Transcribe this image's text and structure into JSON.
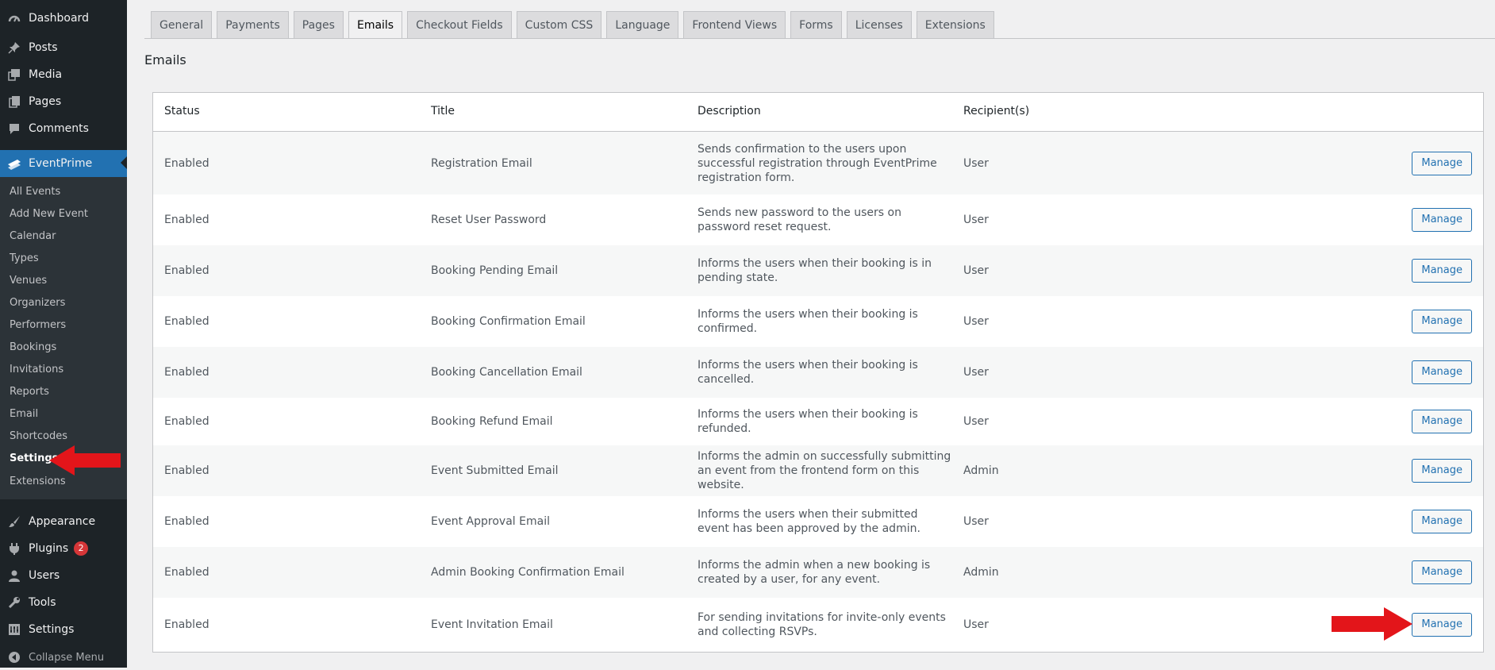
{
  "sidebar": {
    "items": [
      {
        "label": "Dashboard",
        "icon": "dashboard-icon"
      },
      {
        "label": "Posts",
        "icon": "pushpin-icon"
      },
      {
        "label": "Media",
        "icon": "media-icon"
      },
      {
        "label": "Pages",
        "icon": "pages-icon"
      },
      {
        "label": "Comments",
        "icon": "comments-icon"
      },
      {
        "label": "EventPrime",
        "icon": "eventprime-icon"
      }
    ],
    "submenu": [
      "All Events",
      "Add New Event",
      "Calendar",
      "Types",
      "Venues",
      "Organizers",
      "Performers",
      "Bookings",
      "Invitations",
      "Reports",
      "Email",
      "Shortcodes",
      "Settings",
      "Extensions"
    ],
    "current_submenu": "Settings",
    "bottom_items": [
      {
        "label": "Appearance",
        "icon": "paintbrush-icon"
      },
      {
        "label": "Plugins",
        "icon": "plugins-icon",
        "badge": "2"
      },
      {
        "label": "Users",
        "icon": "users-icon"
      },
      {
        "label": "Tools",
        "icon": "tools-icon"
      },
      {
        "label": "Settings",
        "icon": "settings-icon"
      }
    ],
    "collapse_label": "Collapse Menu"
  },
  "tabs": [
    "General",
    "Payments",
    "Pages",
    "Emails",
    "Checkout Fields",
    "Custom CSS",
    "Language",
    "Frontend Views",
    "Forms",
    "Licenses",
    "Extensions"
  ],
  "active_tab": "Emails",
  "page_title": "Emails",
  "table": {
    "headers": {
      "status": "Status",
      "title": "Title",
      "description": "Description",
      "recipients": "Recipient(s)"
    },
    "rows": [
      {
        "status": "Enabled",
        "title": "Registration Email",
        "description": "Sends confirmation to the users upon successful registration through EventPrime registration form.",
        "recipient": "User",
        "action": "Manage"
      },
      {
        "status": "Enabled",
        "title": "Reset User Password",
        "description": "Sends new password to the users on password reset request.",
        "recipient": "User",
        "action": "Manage"
      },
      {
        "status": "Enabled",
        "title": "Booking Pending Email",
        "description": "Informs the users when their booking is in pending state.",
        "recipient": "User",
        "action": "Manage"
      },
      {
        "status": "Enabled",
        "title": "Booking Confirmation Email",
        "description": "Informs the users when their booking is confirmed.",
        "recipient": "User",
        "action": "Manage"
      },
      {
        "status": "Enabled",
        "title": "Booking Cancellation Email",
        "description": "Informs the users when their booking is cancelled.",
        "recipient": "User",
        "action": "Manage"
      },
      {
        "status": "Enabled",
        "title": "Booking Refund Email",
        "description": "Informs the users when their booking is refunded.",
        "recipient": "User",
        "action": "Manage"
      },
      {
        "status": "Enabled",
        "title": "Event Submitted Email",
        "description": "Informs the admin on successfully submitting an event from the frontend form on this website.",
        "recipient": "Admin",
        "action": "Manage"
      },
      {
        "status": "Enabled",
        "title": "Event Approval Email",
        "description": "Informs the users when their submitted event has been approved by the admin.",
        "recipient": "User",
        "action": "Manage"
      },
      {
        "status": "Enabled",
        "title": "Admin Booking Confirmation Email",
        "description": "Informs the admin when a new booking is created by a user, for any event.",
        "recipient": "Admin",
        "action": "Manage"
      },
      {
        "status": "Enabled",
        "title": "Event Invitation Email",
        "description": "For sending invitations for invite-only events and collecting RSVPs.",
        "recipient": "User",
        "action": "Manage"
      }
    ]
  },
  "colors": {
    "sidebar_bg": "#1d2327",
    "accent": "#2271b1",
    "annotation_arrow": "#e3151a",
    "badge": "#d63638"
  }
}
